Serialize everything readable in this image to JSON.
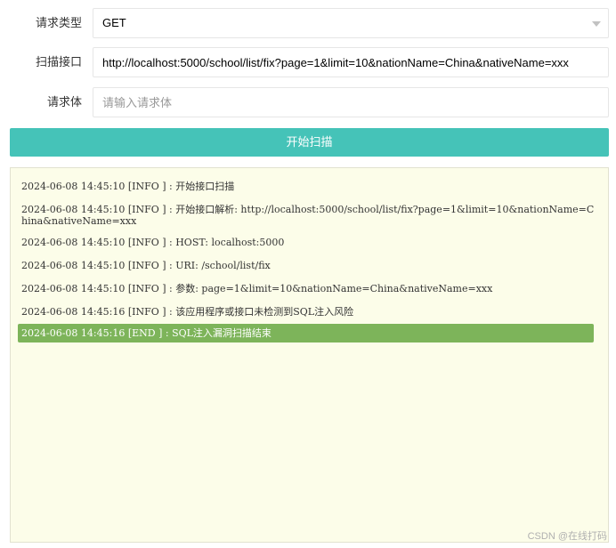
{
  "form": {
    "method": {
      "label": "请求类型",
      "value": "GET"
    },
    "url": {
      "label": "扫描接口",
      "value": "http://localhost:5000/school/list/fix?page=1&limit=10&nationName=China&nativeName=xxx"
    },
    "body": {
      "label": "请求体",
      "value": "",
      "placeholder": "请输入请求体"
    }
  },
  "scan_button": {
    "label": "开始扫描",
    "color": "#45c3b8"
  },
  "log": {
    "lines": [
      "2024-06-08 14:45:10 [INFO ] : 开始接口扫描",
      "2024-06-08 14:45:10 [INFO ] : 开始接口解析: http://localhost:5000/school/list/fix?page=1&limit=10&nationName=China&nativeName=xxx",
      "2024-06-08 14:45:10 [INFO ] : HOST: localhost:5000",
      "2024-06-08 14:45:10 [INFO ] : URI: /school/list/fix",
      "2024-06-08 14:45:10 [INFO ] : 参数: page=1&limit=10&nationName=China&nativeName=xxx",
      "2024-06-08 14:45:16 [INFO ] : 该应用程序或接口未检测到SQL注入风险",
      "2024-06-08 14:45:16 [END ] : SQL注入漏洞扫描结束"
    ],
    "end_highlight_color": "#7db45a",
    "background_color": "#fcfde9"
  },
  "watermark": "CSDN @在线打码"
}
